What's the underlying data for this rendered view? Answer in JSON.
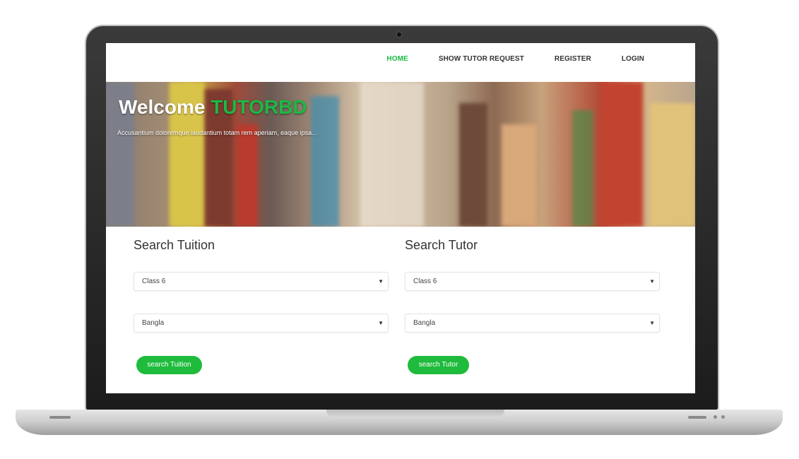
{
  "nav": {
    "items": [
      {
        "label": "HOME",
        "active": true
      },
      {
        "label": "SHOW TUTOR REQUEST",
        "active": false
      },
      {
        "label": "REGISTER",
        "active": false
      },
      {
        "label": "LOGIN",
        "active": false
      }
    ]
  },
  "hero": {
    "welcome": "Welcome",
    "brand": "TUTORBD",
    "subtitle": "Accusantium doloremque laudantium totam rem aperiam, eaque ipsa..."
  },
  "search_tuition": {
    "title": "Search Tuition",
    "class_value": "Class 6",
    "subject_value": "Bangla",
    "button_label": "search Tuition"
  },
  "search_tutor": {
    "title": "Search Tutor",
    "class_value": "Class 6",
    "subject_value": "Bangla",
    "button_label": "search Tutor"
  },
  "colors": {
    "accent": "#1db843",
    "button": "#1fbb3c"
  }
}
